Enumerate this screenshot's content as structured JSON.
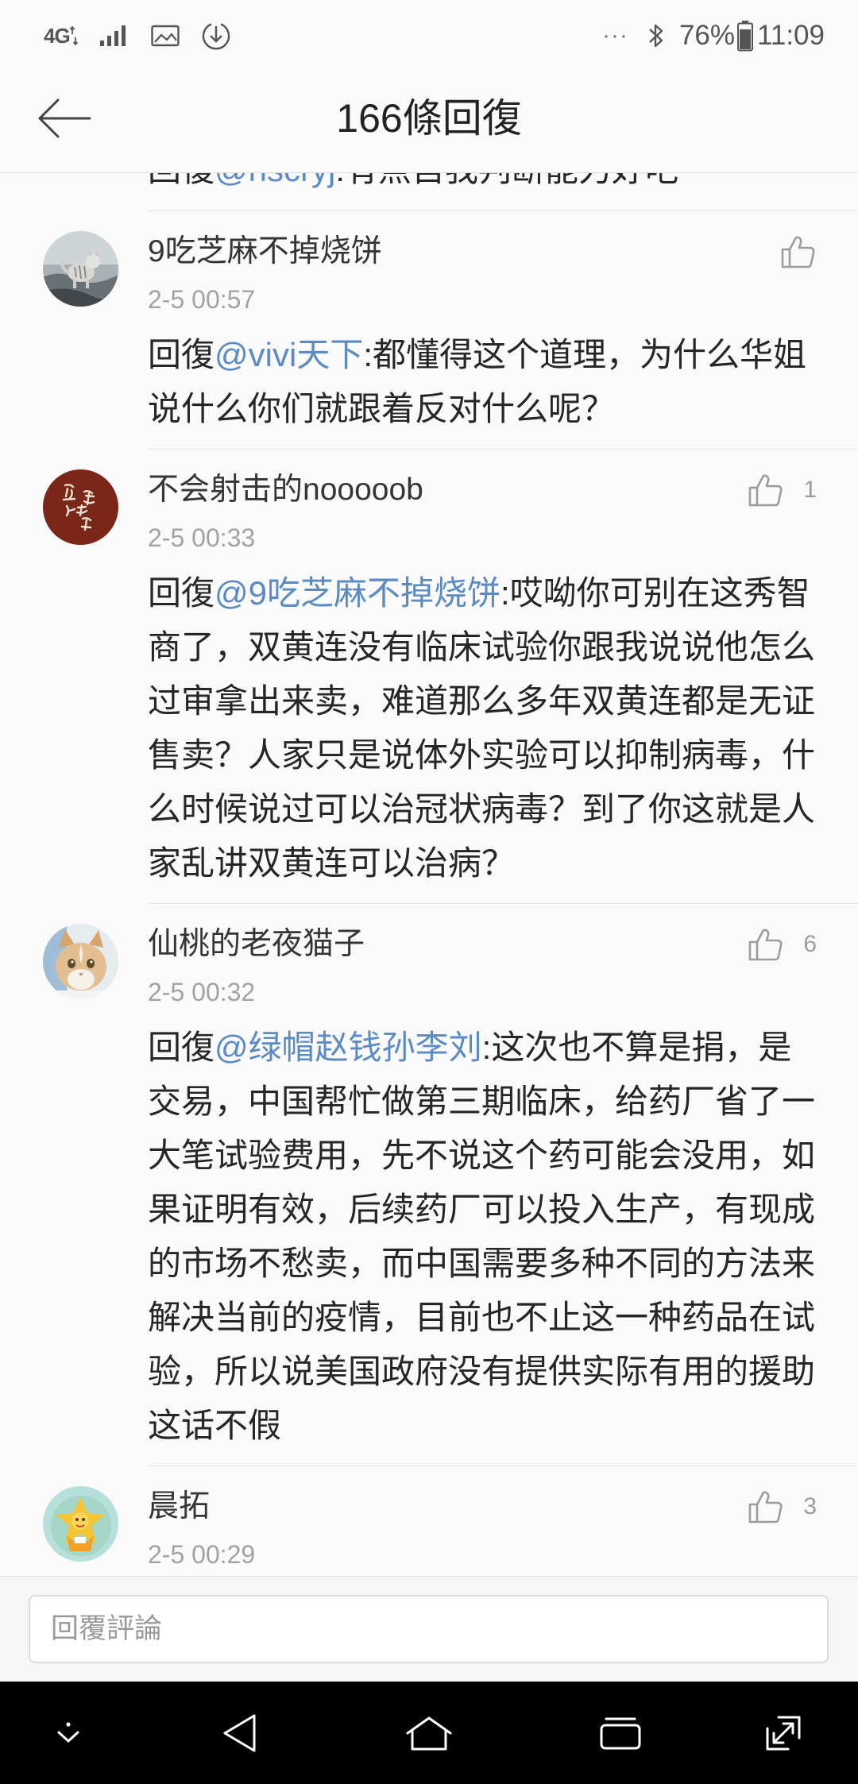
{
  "colors": {
    "bg": "#fafafa",
    "text": "#262626",
    "mention": "#5b8bc2",
    "muted": "#a3a3a3",
    "nav": "#000000"
  },
  "status_bar": {
    "network": "4G",
    "left_icons": [
      "network-4g-icon",
      "signal-bars-icon",
      "image-notification-icon",
      "download-notification-icon"
    ],
    "more_indicator": "···",
    "right_icons": [
      "bluetooth-icon",
      "battery-icon"
    ],
    "battery_percent": "76%",
    "time": "11:09"
  },
  "header": {
    "back_icon": "back-arrow-icon",
    "title": "166條回復"
  },
  "partial_reply": {
    "reply_prefix": "回復",
    "mention": "@hscryj",
    "text": ":有点自我判断能力好吧"
  },
  "comments": [
    {
      "author": "9吃芝麻不掉烧饼",
      "time": "2-5 00:57",
      "likes": null,
      "reply_prefix": "回復",
      "mention": "@vivi天下",
      "text": ":都懂得这个道理，为什么华姐说什么你们就跟着反对什么呢？"
    },
    {
      "author": "不会射击的nooooob",
      "time": "2-5 00:33",
      "likes": 1,
      "reply_prefix": "回復",
      "mention": "@9吃芝麻不掉烧饼",
      "text": ":哎呦你可别在这秀智商了，双黄连没有临床试验你跟我说说他怎么过审拿出来卖，难道那么多年双黄连都是无证售卖？人家只是说体外实验可以抑制病毒，什么时候说过可以治冠状病毒？到了你这就是人家乱讲双黄连可以治病？"
    },
    {
      "author": "仙桃的老夜猫子",
      "time": "2-5 00:32",
      "likes": 6,
      "reply_prefix": "回復",
      "mention": "@绿帽赵钱孙李刘",
      "text": ":这次也不算是捐，是交易，中国帮忙做第三期临床，给药厂省了一大笔试验费用，先不说这个药可能会没用，如果证明有效，后续药厂可以投入生产，有现成的市场不愁卖，而中国需要多种不同的方法来解决当前的疫情，目前也不止这一种药品在试验，所以说美国政府没有提供实际有用的援助这话不假"
    },
    {
      "author": "晨拓",
      "time": "2-5 00:29",
      "likes": 3
    }
  ],
  "like_icon": "thumbs-up-icon",
  "reply_input": {
    "placeholder": "回覆評論"
  },
  "nav_bar": {
    "icons": [
      "chevron-down-icon",
      "back-triangle-icon",
      "home-icon",
      "recent-apps-icon",
      "expand-icon"
    ]
  }
}
